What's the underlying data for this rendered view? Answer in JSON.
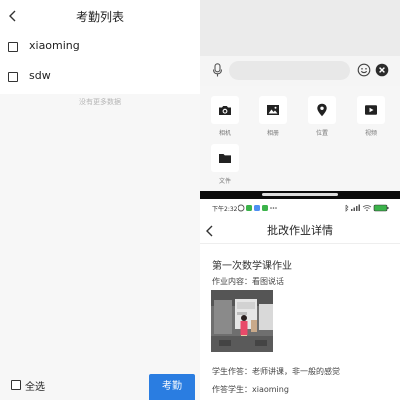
{
  "checkin_list": {
    "title": "考勤列表",
    "students": [
      {
        "name": "xiaoming"
      },
      {
        "name": "sdw"
      }
    ],
    "no_more": "没有更多数据",
    "select_all": "全选",
    "checkin_button": "考勤"
  },
  "chat_panel": {
    "tools": [
      {
        "label": "相机",
        "icon": "camera-icon"
      },
      {
        "label": "相册",
        "icon": "image-icon"
      },
      {
        "label": "位置",
        "icon": "location-icon"
      },
      {
        "label": "视频",
        "icon": "video-icon"
      },
      {
        "label": "文件",
        "icon": "folder-icon"
      }
    ]
  },
  "homework_detail": {
    "status_time": "下午2:32",
    "title": "批改作业详情",
    "homework_title": "第一次数学课作业",
    "content": "作业内容：看图说话",
    "answer": "学生作答：老师讲课，非一般的感觉",
    "student": "作答学生：xiaoming"
  },
  "colors": {
    "accent": "#2a7de1",
    "divider": "#0b0b0b"
  }
}
